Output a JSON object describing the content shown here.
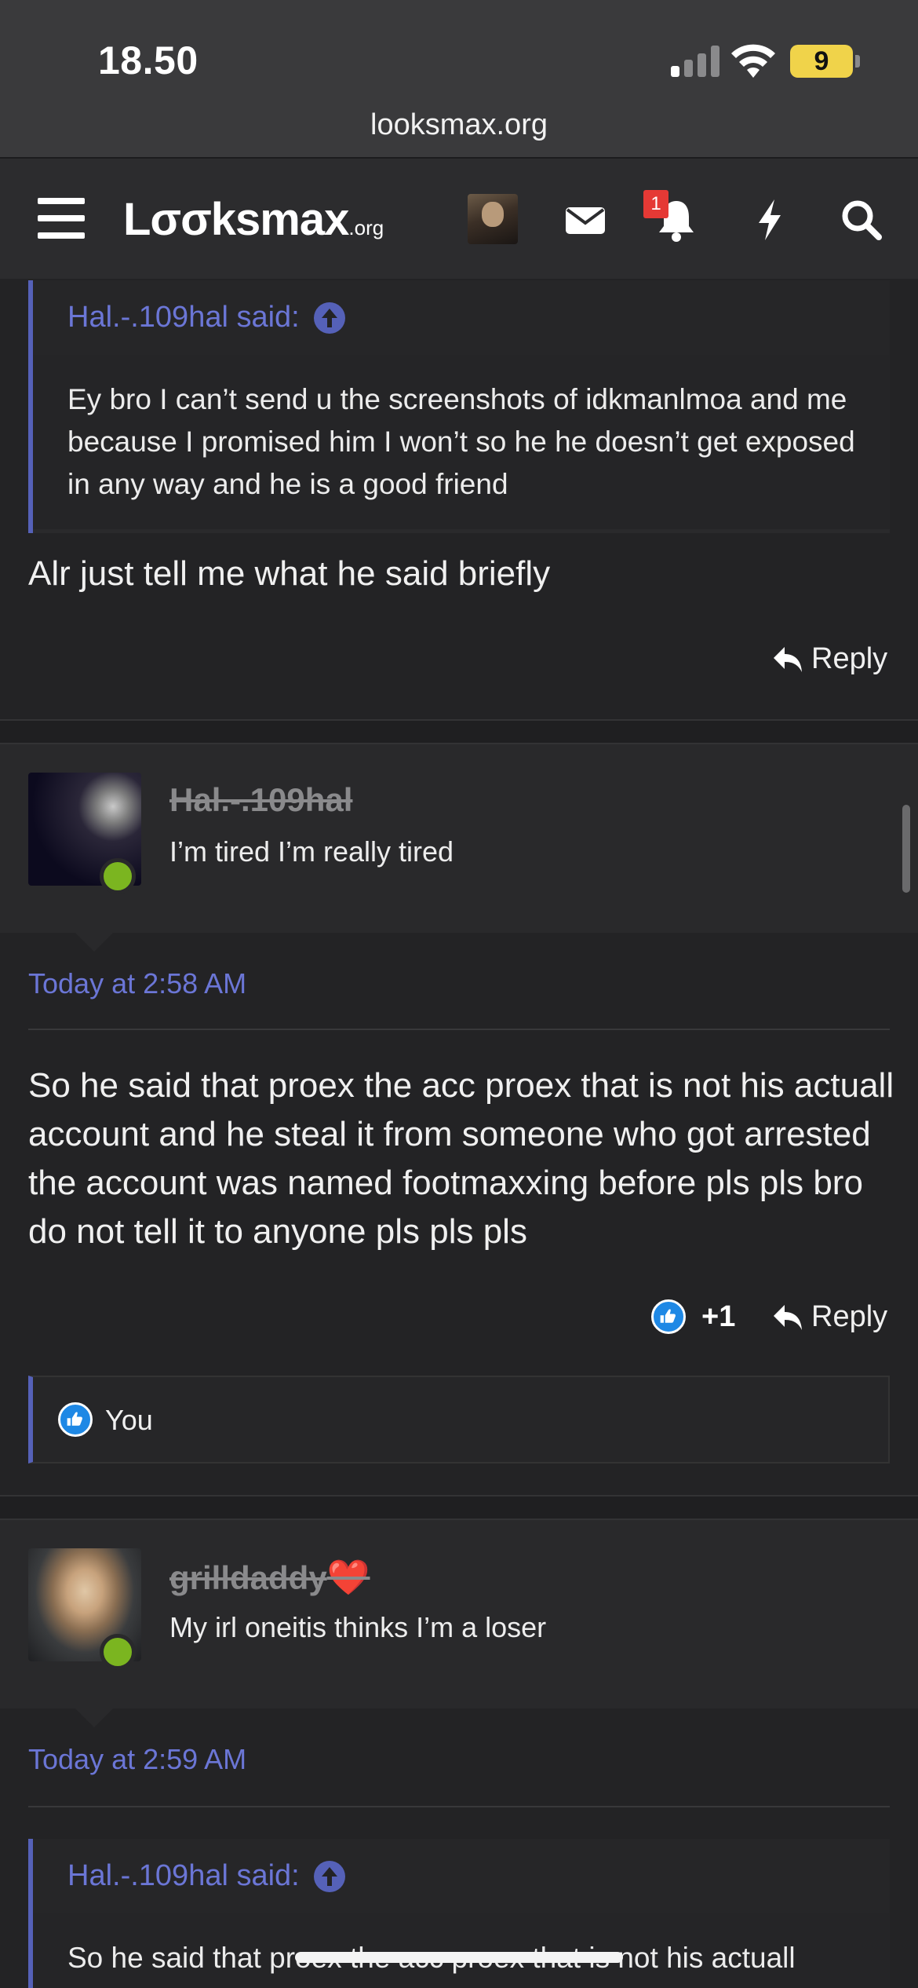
{
  "status_bar": {
    "time": "18.50",
    "battery": "9",
    "url": "looksmax.org"
  },
  "nav": {
    "logo": "Lσσksmax",
    "logo_suffix": ".org",
    "notification_count": "1",
    "icons": [
      "menu-icon",
      "avatar",
      "envelope-icon",
      "bell-icon",
      "bolt-icon",
      "search-icon"
    ]
  },
  "posts": [
    {
      "quote": {
        "author": "Hal.-.109hal said:",
        "text": "Ey bro I can’t send u the screenshots of idkmanlmoa and me because I promised him I won’t so he he doesn’t get exposed in any way and he is a good friend"
      },
      "body": "Alr just tell me what he said briefly",
      "reply_label": "Reply"
    },
    {
      "username": "Hal.-.109hal",
      "user_title": "I’m tired I’m really tired",
      "date": "Today at 2:58 AM",
      "body": "So he said that proex the acc proex that is not his actuall account and he steal it from someone who got arrested the account was named footmaxxing before pls pls bro do not tell it to anyone pls pls pls",
      "reaction_count": "+1",
      "reply_label": "Reply",
      "reactions_by": "You"
    },
    {
      "username": "grilldaddy",
      "username_emoji": "❤️",
      "user_title": "My irl oneitis thinks I’m a loser",
      "date": "Today at 2:59 AM",
      "quote": {
        "author": "Hal.-.109hal said:",
        "text": "So he said that proex the acc proex that is not his actuall"
      }
    }
  ],
  "colors": {
    "accent": "#6b76d6",
    "online": "#7bb520",
    "badge": "#e53935",
    "like": "#1e88e5"
  }
}
